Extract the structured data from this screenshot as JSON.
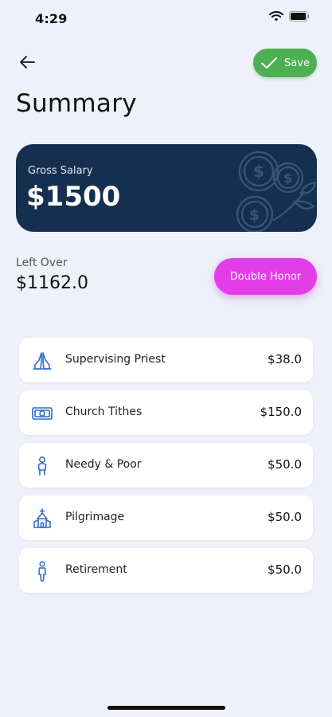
{
  "status_bar": {
    "time": "4:29"
  },
  "header": {
    "title": "Summary",
    "save_label": "Save"
  },
  "salary_card": {
    "label": "Gross Salary",
    "value": "$1500"
  },
  "leftover": {
    "label": "Left Over",
    "value": "$1162.0"
  },
  "double_honor": {
    "label": "Double Honor"
  },
  "expenses": [
    {
      "icon": "praying-hands-icon",
      "label": "Supervising Priest",
      "amount": "$38.0"
    },
    {
      "icon": "money-bill-icon",
      "label": "Church Tithes",
      "amount": "$150.0"
    },
    {
      "icon": "person-icon",
      "label": "Needy & Poor",
      "amount": "$50.0"
    },
    {
      "icon": "church-icon",
      "label": "Pilgrimage",
      "amount": "$50.0"
    },
    {
      "icon": "person-standing-icon",
      "label": "Retirement",
      "amount": "$50.0"
    }
  ],
  "colors": {
    "background": "#eef1f9",
    "card": "#15304f",
    "save": "#4caf50",
    "double_honor": "#e23de8",
    "icon_accent": "#2f6fc9"
  }
}
